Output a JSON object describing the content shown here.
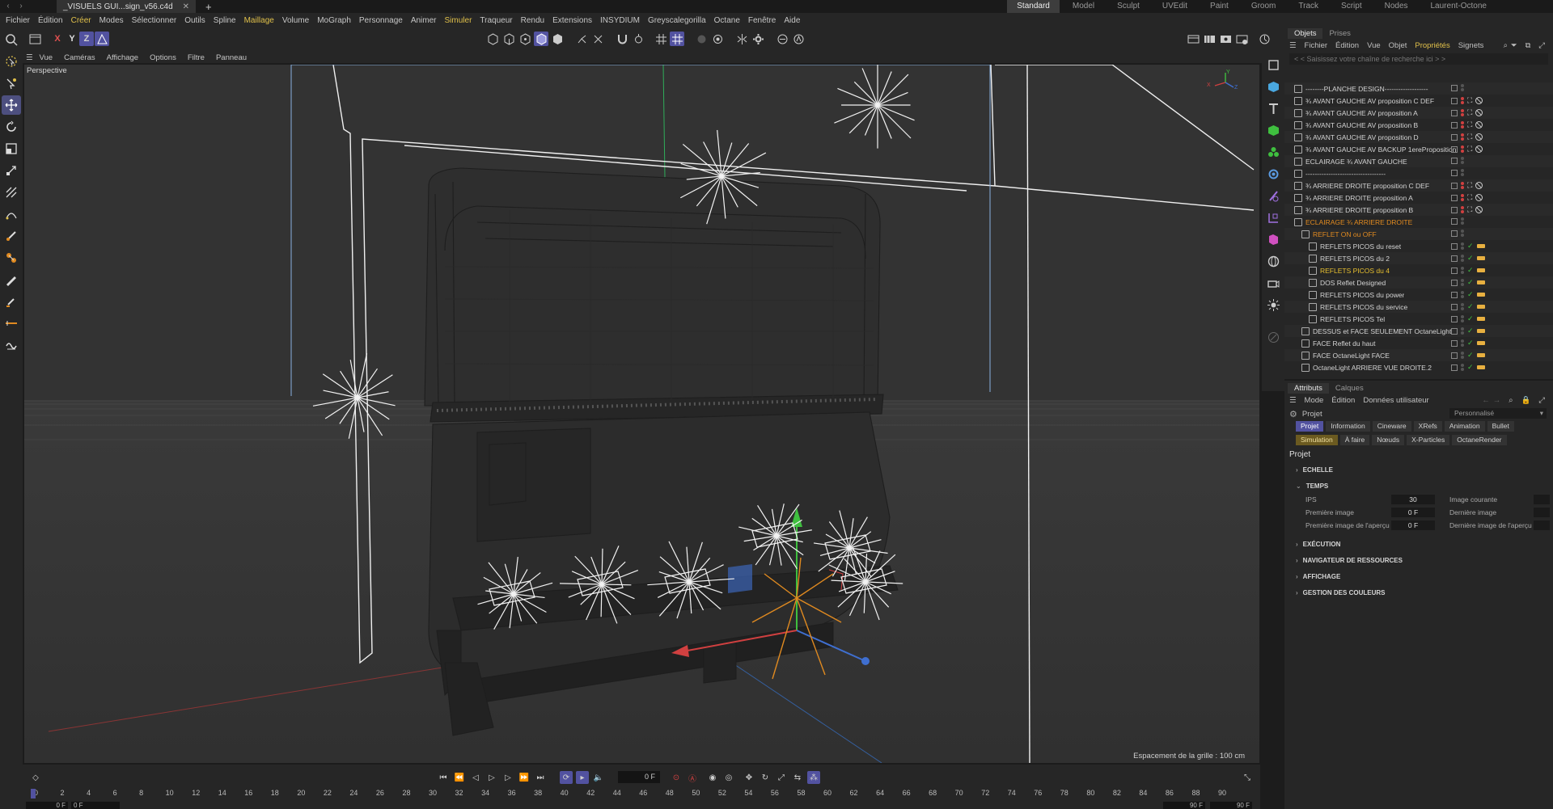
{
  "document": {
    "tab_title": "_VISUELS GUI...sign_v56.c4d"
  },
  "layouts": [
    "Standard",
    "Model",
    "Sculpt",
    "UVEdit",
    "Paint",
    "Groom",
    "Track",
    "Script",
    "Nodes",
    "Laurent-Octone"
  ],
  "menus": [
    "Fichier",
    "Édition",
    "Créer",
    "Modes",
    "Sélectionner",
    "Outils",
    "Spline",
    "Maillage",
    "Volume",
    "MoGraph",
    "Personnage",
    "Animer",
    "Simuler",
    "Traqueur",
    "Rendu",
    "Extensions",
    "INSYDIUM",
    "Greyscalegorilla",
    "Octane",
    "Fenêtre",
    "Aide"
  ],
  "axis_buttons": {
    "x": "X",
    "y": "Y",
    "z": "Z"
  },
  "viewport": {
    "menu": [
      "Vue",
      "Caméras",
      "Affichage",
      "Options",
      "Filtre",
      "Panneau"
    ],
    "camera_label": "Perspective",
    "grid_spacing": "Espacement de la grille : 100 cm",
    "axis_gizmo": {
      "x": "X",
      "y": "Y",
      "z": "Z"
    }
  },
  "timeline": {
    "current_frame": "0 F",
    "ticks": [
      "0",
      "2",
      "4",
      "6",
      "8",
      "10",
      "12",
      "14",
      "16",
      "18",
      "20",
      "22",
      "24",
      "26",
      "28",
      "30",
      "32",
      "34",
      "36",
      "38",
      "40",
      "42",
      "44",
      "46",
      "48",
      "50",
      "52",
      "54",
      "56",
      "58",
      "60",
      "62",
      "64",
      "66",
      "68",
      "70",
      "72",
      "74",
      "76",
      "78",
      "80",
      "82",
      "84",
      "86",
      "88",
      "90"
    ],
    "range_start": "0 F",
    "range_start2": "0 F",
    "range_end": "90 F",
    "range_end2": "90 F"
  },
  "objects_panel": {
    "tabs": [
      "Objets",
      "Prises"
    ],
    "menu": [
      "Fichier",
      "Édition",
      "Vue",
      "Objet",
      "Propriétés",
      "Signets"
    ],
    "search_placeholder": "< < Saisissez votre chaîne de recherche ici > >",
    "rows": [
      {
        "name": "--------PLANCHE DESIGN-------------------",
        "style": "normal",
        "indent": 0,
        "tags": "none"
      },
      {
        "name": "¾ AVANT GAUCHE AV proposition C DEF",
        "style": "normal",
        "indent": 0,
        "tags": "cam"
      },
      {
        "name": "¾ AVANT GAUCHE AV proposition A",
        "style": "normal",
        "indent": 0,
        "tags": "cam"
      },
      {
        "name": "¾ AVANT GAUCHE AV proposition B",
        "style": "normal",
        "indent": 0,
        "tags": "cam"
      },
      {
        "name": "¾ AVANT GAUCHE AV proposition D",
        "style": "normal",
        "indent": 0,
        "tags": "cam"
      },
      {
        "name": "¾ AVANT GAUCHE AV BACKUP 1ereProposition",
        "style": "normal",
        "indent": 0,
        "tags": "cam"
      },
      {
        "name": "ECLAIRAGE ¾ AVANT GAUCHE",
        "style": "normal",
        "indent": 0,
        "tags": "none"
      },
      {
        "name": "-----------------------------------",
        "style": "normal",
        "indent": 0,
        "tags": "none"
      },
      {
        "name": "¾ ARRIERE DROITE proposition C DEF",
        "style": "normal",
        "indent": 0,
        "tags": "cam"
      },
      {
        "name": "¾ ARRIERE DROITE proposition A",
        "style": "normal",
        "indent": 0,
        "tags": "cam"
      },
      {
        "name": "¾ ARRIERE DROITE proposition B",
        "style": "normal",
        "indent": 0,
        "tags": "cam"
      },
      {
        "name": "ECLAIRAGE ¾ ARRIERE DROITE",
        "style": "orange",
        "indent": 0,
        "tags": "none"
      },
      {
        "name": "REFLET ON ou OFF",
        "style": "orange",
        "indent": 1,
        "tags": "none"
      },
      {
        "name": "REFLETS PICOS du reset",
        "style": "normal",
        "indent": 2,
        "tags": "light"
      },
      {
        "name": "REFLETS PICOS du 2",
        "style": "normal",
        "indent": 2,
        "tags": "light"
      },
      {
        "name": "REFLETS PICOS du 4",
        "style": "yellow",
        "indent": 2,
        "tags": "light"
      },
      {
        "name": "DOS Reflet Designed",
        "style": "normal",
        "indent": 2,
        "tags": "light"
      },
      {
        "name": "REFLETS PICOS du power",
        "style": "normal",
        "indent": 2,
        "tags": "light"
      },
      {
        "name": "REFLETS PICOS du service",
        "style": "normal",
        "indent": 2,
        "tags": "light"
      },
      {
        "name": "REFLETS PICOS Tel",
        "style": "normal",
        "indent": 2,
        "tags": "light"
      },
      {
        "name": "DESSUS et FACE SEULEMENT OctaneLight",
        "style": "normal",
        "indent": 1,
        "tags": "light"
      },
      {
        "name": "FACE Reflet du haut",
        "style": "normal",
        "indent": 1,
        "tags": "light"
      },
      {
        "name": "FACE OctaneLight FACE",
        "style": "normal",
        "indent": 1,
        "tags": "light"
      },
      {
        "name": "OctaneLight ARRIERE VUE DROITE.2",
        "style": "normal",
        "indent": 1,
        "tags": "light"
      }
    ]
  },
  "attributes_panel": {
    "tabs": [
      "Attributs",
      "Calques"
    ],
    "menu": [
      "Mode",
      "Édition",
      "Données utilisateur"
    ],
    "context": "Projet",
    "preset": "Personnalisé",
    "buttons_row1": [
      "Projet",
      "Information",
      "Cineware",
      "XRefs",
      "Animation",
      "Bullet"
    ],
    "buttons_row2": [
      "Simulation",
      "À faire",
      "Nœuds",
      "X-Particles",
      "OctaneRender"
    ],
    "heading": "Projet",
    "sections": [
      "ECHELLE",
      "TEMPS",
      "EXÉCUTION",
      "NAVIGATEUR DE RESSOURCES",
      "AFFICHAGE",
      "GESTION DES COULEURS"
    ],
    "temps": {
      "ips_label": "IPS",
      "ips_value": "30",
      "first_label": "Première image",
      "first_value": "0 F",
      "first_preview_label": "Première image de l'aperçu",
      "first_preview_value": "0 F",
      "current_label": "Image courante",
      "last_label": "Dernière image",
      "last_preview_label": "Dernière image de l'aperçu"
    }
  },
  "colors": {
    "accent": "#5252a0",
    "orange": "#e08a20",
    "yellow": "#e8c030",
    "green": "#3fbf3f"
  }
}
